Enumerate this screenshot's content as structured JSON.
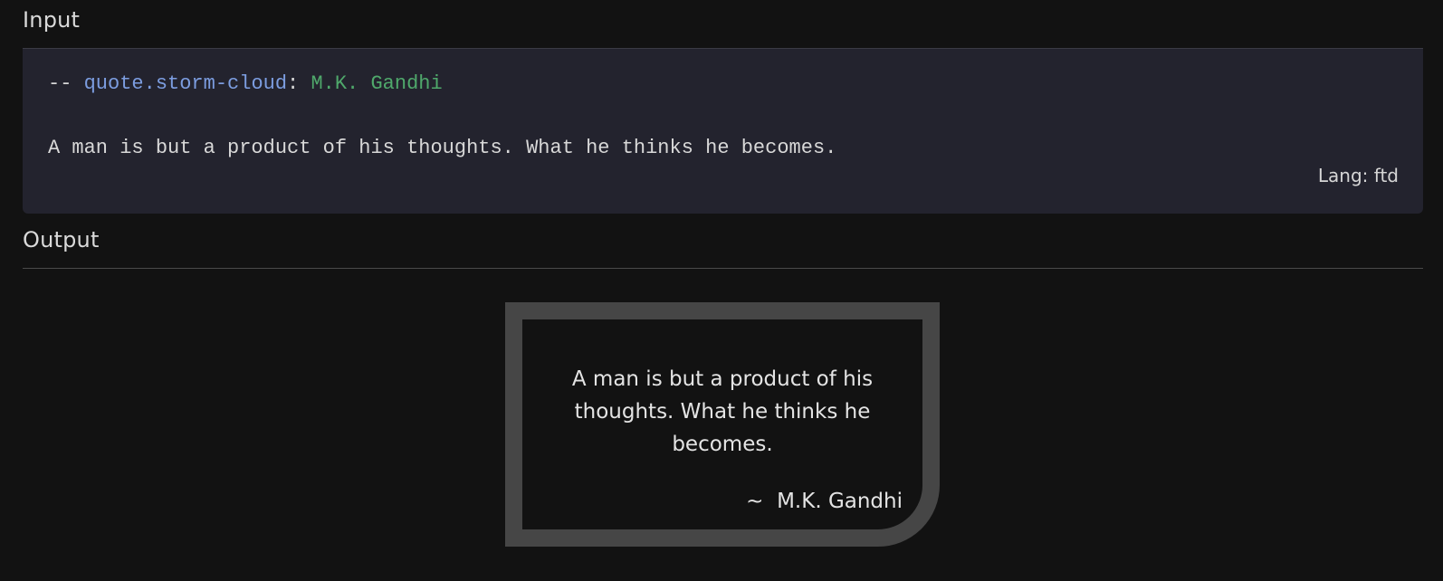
{
  "input_section": {
    "label": "Input",
    "code": {
      "dash": "-- ",
      "key": "quote.storm-cloud",
      "colon": ": ",
      "value": "M.K. Gandhi",
      "body": "A man is but a product of his thoughts. What he thinks he becomes."
    },
    "lang": "Lang: ftd"
  },
  "output_section": {
    "label": "Output",
    "quote": {
      "text": "A man is but a product of his thoughts. What he thinks he becomes.",
      "tilde": "~  ",
      "author": "M.K. Gandhi"
    }
  },
  "colors": {
    "background": "#121212",
    "code_background": "#23232e",
    "key_blue": "#7c9de0",
    "value_green": "#4fa86b",
    "card_border": "#464646"
  }
}
